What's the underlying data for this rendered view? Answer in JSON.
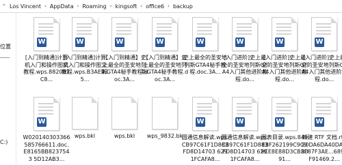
{
  "addressbar": {
    "lead_icon": "chevron-up-icon",
    "breadcrumbs": [
      "Los Vincent",
      "AppData",
      "Roaming",
      "kingsoft",
      "office6",
      "backup"
    ],
    "separator": "›"
  },
  "sidebar": {
    "items": [
      "位置",
      "C:)"
    ]
  },
  "files": [
    {
      "name": "[入门到精通]计算机入门和操作图文教程.wps.882091C8...",
      "type": "wps-doc"
    },
    {
      "name": "[入门到精通]计算机入门和操作图文教程.wps.B3AE925...",
      "type": "wps-doc"
    },
    {
      "name": "【入门到精通】史上最全的圣安地列斯GTA4秘手教程.doc.3A...",
      "type": "wps-doc"
    },
    {
      "name": "【入门到精通】史上最全的圣安地列斯GTA4秘手教程.doc.3A...",
      "type": "wps-doc"
    },
    {
      "name": "史上最全的圣安地列斯GTA4秘手教程.doc.3A...",
      "type": "wps-doc"
    },
    {
      "name": "[入门进阶]史上最全的圣安地列斯GTA4入门其他进阶教程.do...",
      "type": "wps-doc"
    },
    {
      "name": "[入门进阶]史上最全的圣安地列斯GTA4入门其他进阶教程.do...",
      "type": "wps-doc"
    },
    {
      "name": "[入门进阶]史上最全的圣安地列斯GTA4入门其他进阶教程.do...",
      "type": "wps-doc"
    },
    {
      "name": "W020140303366585766611.doc.E8165BB8237543 5D12AB3...",
      "type": "wps-doc"
    },
    {
      "name": "wps.bkl",
      "type": "plain"
    },
    {
      "name": "wps.bkl",
      "type": "plain"
    },
    {
      "name": "wps_9832.bk",
      "type": "plain"
    },
    {
      "name": "圆通信息解读.wps.CB97C61F1D883FD8D14703 6291FCAFA8...",
      "type": "wps-doc"
    },
    {
      "name": "圆通信息解读.wps.CB97C61F1D883FD8D14703 6291FCAFA8...",
      "type": "wps-doc"
    },
    {
      "name": "图表目录.wps.849E8F262199C9099CE8E88D3CB3D91...",
      "type": "wps-doc"
    },
    {
      "name": "新建 RTF 文档.rtf.20DA6DA40DAB8F87F3AE...6894F91469.2...",
      "type": "wps-doc"
    }
  ],
  "icons": {
    "wps_badge": "W"
  },
  "colors": {
    "wps_blue": "#2b5797"
  }
}
